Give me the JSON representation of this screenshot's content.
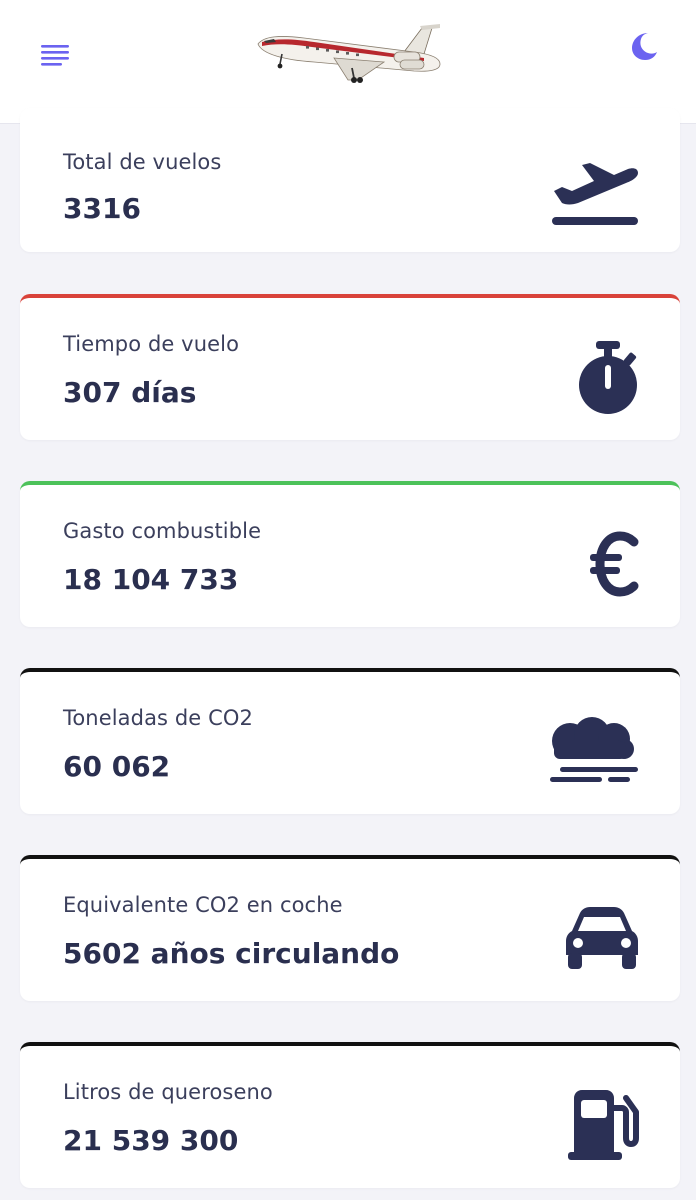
{
  "header": {
    "menu_icon": "hamburger-menu-icon",
    "logo": "airplane-logo",
    "theme_toggle_icon": "moon-icon",
    "accent_color": "#6b63f0"
  },
  "stats": [
    {
      "label": "Total de vuelos",
      "value": "3316",
      "icon": "plane-takeoff-icon",
      "accent": ""
    },
    {
      "label": "Tiempo de vuelo",
      "value": "307 días",
      "icon": "stopwatch-icon",
      "accent": "#d9423a"
    },
    {
      "label": "Gasto combustible",
      "value": "18 104 733",
      "icon": "euro-icon",
      "accent": "#4cc25a"
    },
    {
      "label": "Toneladas de CO2",
      "value": "60 062",
      "icon": "smog-icon",
      "accent": "#111111"
    },
    {
      "label": "Equivalente CO2 en coche",
      "value": "5602 años circulando",
      "icon": "car-icon",
      "accent": "#111111"
    },
    {
      "label": "Litros de queroseno",
      "value": "21 539 300",
      "icon": "gas-pump-icon",
      "accent": "#111111"
    }
  ],
  "colors": {
    "icon": "#2b3055",
    "background": "#f3f3f8"
  }
}
